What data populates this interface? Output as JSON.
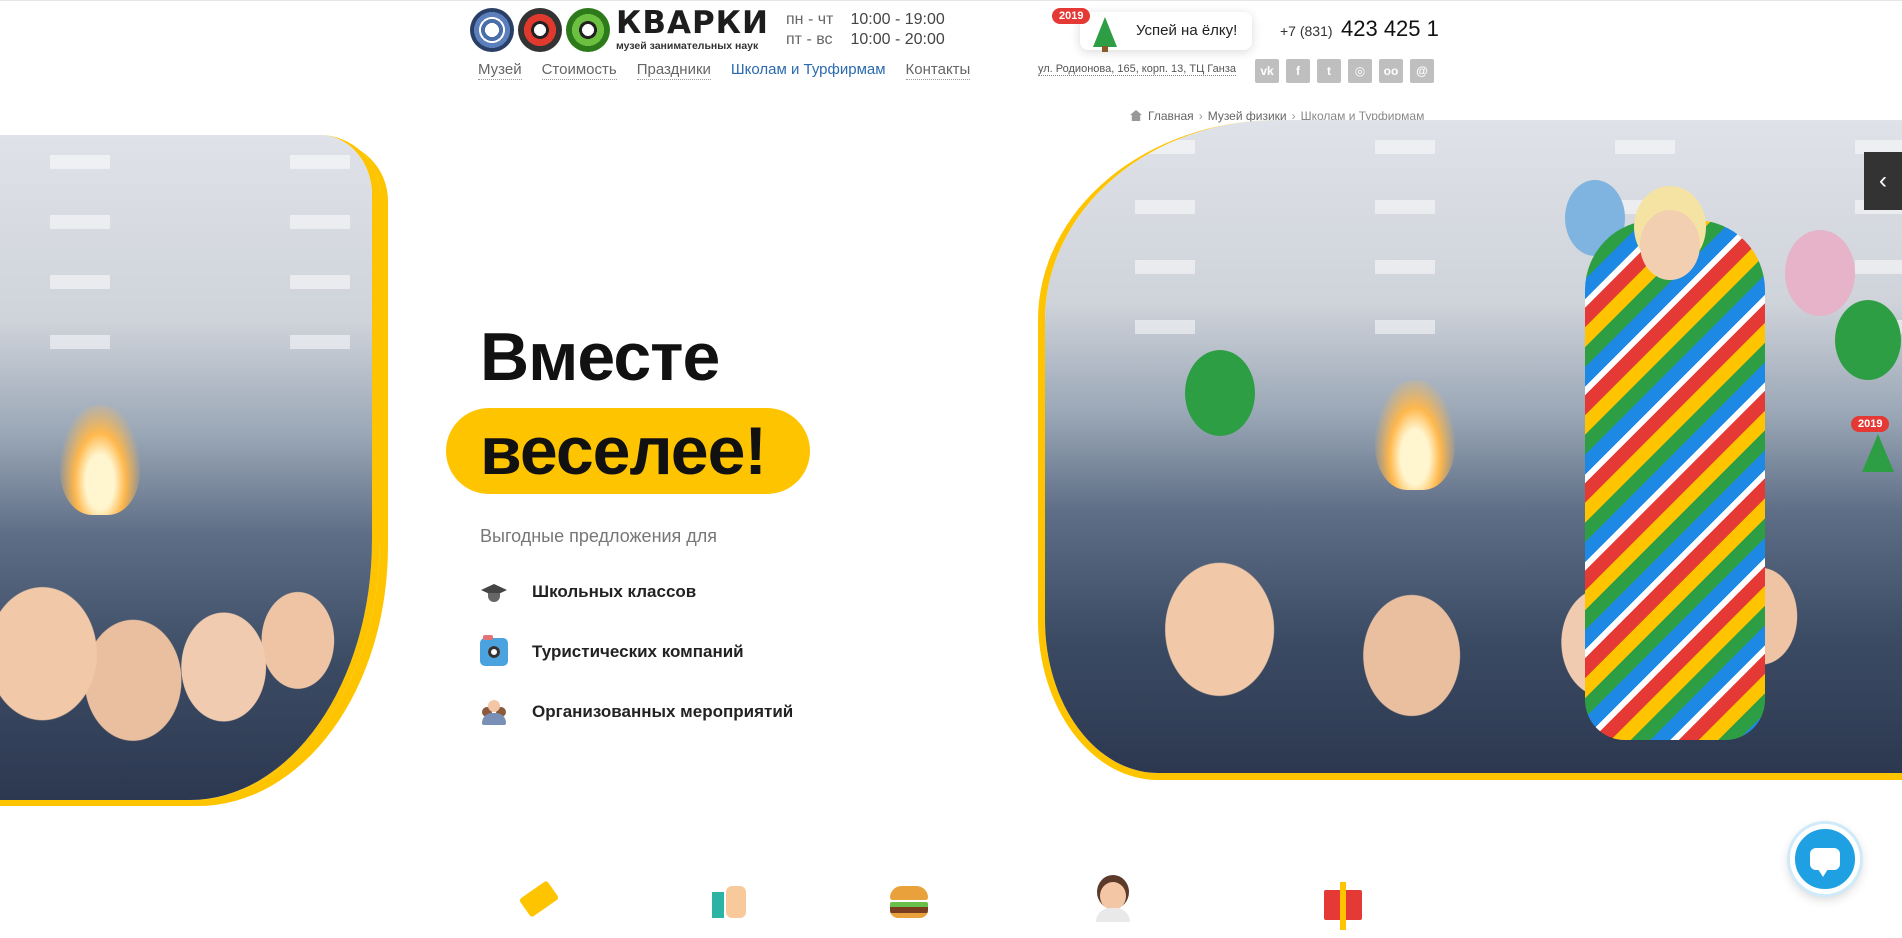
{
  "brand": {
    "name": "КВАРКИ",
    "tagline": "музей занимательных наук"
  },
  "hours": [
    {
      "days": "пн - чт",
      "time": "10:00 - 19:00"
    },
    {
      "days": "пт - вс",
      "time": "10:00 - 20:00"
    }
  ],
  "promo": {
    "badge": "2019",
    "text": "Успей на ёлку!"
  },
  "phone": {
    "prefix": "+7 (831)",
    "number": "423 425 1"
  },
  "nav": [
    {
      "label": "Музей",
      "active": false
    },
    {
      "label": "Стоимость",
      "active": false
    },
    {
      "label": "Праздники",
      "active": false
    },
    {
      "label": "Школам и Турфирмам",
      "active": true
    },
    {
      "label": "Контакты",
      "active": false
    }
  ],
  "address": "ул. Родионова, 165, корп. 13, ТЦ Ганза",
  "socials": [
    {
      "name": "vk-icon",
      "glyph": "vk"
    },
    {
      "name": "facebook-icon",
      "glyph": "f"
    },
    {
      "name": "twitter-icon",
      "glyph": "t"
    },
    {
      "name": "instagram-icon",
      "glyph": "◎"
    },
    {
      "name": "tripadvisor-icon",
      "glyph": "oo"
    },
    {
      "name": "email-icon",
      "glyph": "@"
    }
  ],
  "breadcrumbs": [
    "Главная",
    "Музей физики",
    "Школам и Турфирмам"
  ],
  "hero": {
    "title_line1": "Вместе",
    "title_line2": "веселее!",
    "lead": "Выгодные предложения для",
    "offers": [
      {
        "icon": "graduation-cap-icon",
        "label": "Школьных классов"
      },
      {
        "icon": "camera-icon",
        "label": "Туристических компаний"
      },
      {
        "icon": "people-icon",
        "label": "Организованных мероприятий"
      }
    ]
  },
  "side_badge": "2019",
  "side_tab_glyph": "‹",
  "features": [
    "tag-icon",
    "thumbs-up-icon",
    "burger-icon",
    "girl-icon",
    "gift-icon"
  ],
  "colors": {
    "accent": "#ffc400",
    "link_active": "#2a6ab0",
    "chat": "#1ea0e2",
    "badge": "#e53935"
  }
}
